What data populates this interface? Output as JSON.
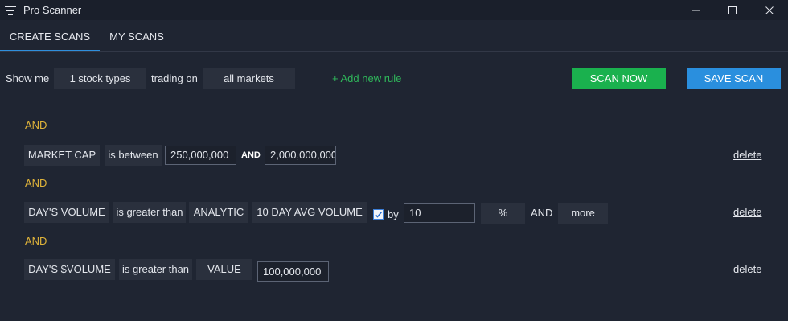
{
  "window": {
    "title": "Pro Scanner",
    "controls": {
      "minimize": "—",
      "maximize": "☐",
      "close": "✕"
    }
  },
  "tabs": [
    {
      "label": "CREATE SCANS",
      "active": true
    },
    {
      "label": "MY SCANS",
      "active": false
    }
  ],
  "toolbar": {
    "show_me": "Show me",
    "stock_types": "1 stock types",
    "trading_on": "trading on",
    "markets": "all markets",
    "add_rule": "+ Add new rule",
    "scan_now": "SCAN NOW",
    "save_scan": "SAVE SCAN"
  },
  "rules": {
    "r1": {
      "connector": "AND",
      "field": "MARKET CAP",
      "op": "is between",
      "min": "250,000,000",
      "and": "AND",
      "max": "2,000,000,000",
      "delete": "delete"
    },
    "r2": {
      "connector": "AND",
      "field": "DAY'S VOLUME",
      "op": "is greater than",
      "type": "ANALYTIC",
      "metric": "10 DAY AVG VOLUME",
      "by_checked": true,
      "by": "by",
      "value": "10",
      "unit": "%",
      "and": "AND",
      "more": "more",
      "delete": "delete"
    },
    "r3": {
      "connector": "AND",
      "field": "DAY'S $VOLUME",
      "op": "is greater than",
      "type": "VALUE",
      "value": "100,000,000",
      "delete": "delete"
    }
  },
  "colors": {
    "background": "#1f2532",
    "accent_blue": "#2a8fde",
    "accent_green": "#1ab14e",
    "and_yellow": "#e0b43a"
  }
}
